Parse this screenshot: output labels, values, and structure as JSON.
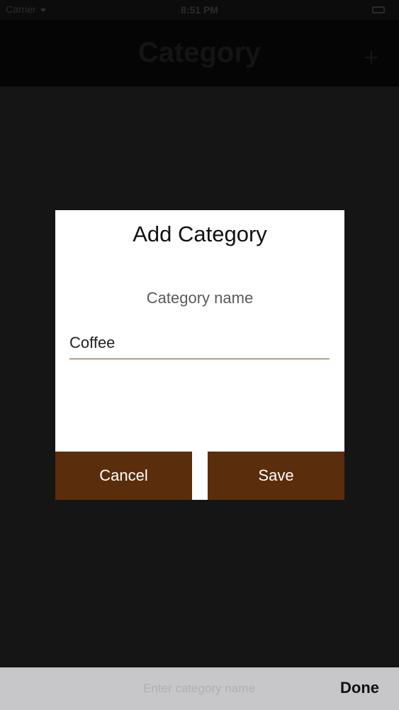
{
  "status_bar": {
    "carrier": "Carrier",
    "time": "8:51 PM"
  },
  "nav": {
    "title": "Category",
    "action_icon": "plus-icon"
  },
  "dialog": {
    "title": "Add Category",
    "field_label": "Category name",
    "name_value": "Coffee",
    "cancel_label": "Cancel",
    "save_label": "Save"
  },
  "accessory": {
    "placeholder": "Enter category name",
    "done_label": "Done"
  },
  "colors": {
    "button_brown": "#5a2d0c",
    "backdrop": "#161516",
    "input_underline": "#6b4a2a",
    "accessory_bg": "#c7c7c9"
  }
}
